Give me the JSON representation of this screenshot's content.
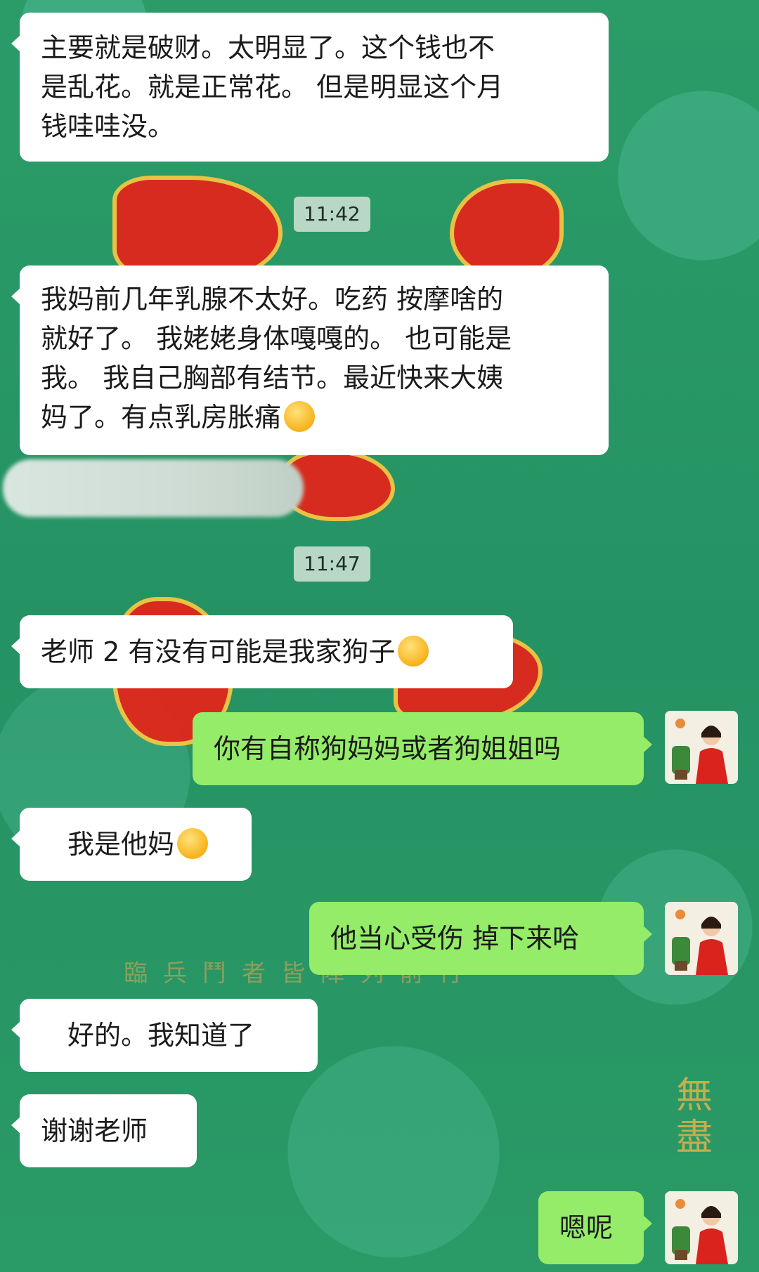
{
  "timestamps": [
    "11:42",
    "11:47"
  ],
  "background_text": {
    "row": "臨兵鬥者皆陣列前行",
    "gold": "無盡"
  },
  "messages": [
    {
      "side": "left",
      "lines": [
        "主要就是破财。太明显了。这个钱也不",
        "是乱花。就是正常花。 但是明显这个月",
        "钱哇哇没。"
      ]
    },
    {
      "side": "left",
      "lines": [
        "我妈前几年乳腺不太好。吃药 按摩啥的",
        "就好了。 我姥姥身体嘎嘎的。 也可能是",
        "我。 我自己胸部有结节。最近快来大姨",
        "妈了。有点乳房胀痛"
      ],
      "emoji": "sad-sigh-emoji"
    },
    {
      "side": "left",
      "text": "老师 2 有没有可能是我家狗子",
      "emoji": "laugh-cry-emoji"
    },
    {
      "side": "right",
      "text": "你有自称狗妈妈或者狗姐姐吗"
    },
    {
      "side": "left",
      "text": "我是他妈",
      "emoji": "smirk-emoji"
    },
    {
      "side": "right",
      "text": "他当心受伤 掉下来哈"
    },
    {
      "side": "left",
      "text": "好的。我知道了"
    },
    {
      "side": "left",
      "text": "谢谢老师"
    },
    {
      "side": "right",
      "text": "嗯呢"
    }
  ],
  "colors": {
    "background": "#2a9a66",
    "left_bubble": "#ffffff",
    "right_bubble": "#95ec69",
    "time_pill": "#b9d7c5"
  }
}
